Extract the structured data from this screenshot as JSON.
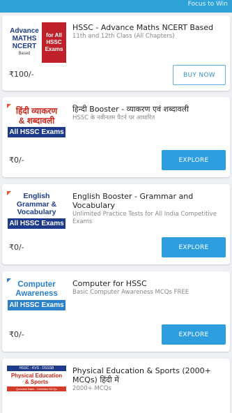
{
  "top_bar": {
    "text": "Focus to Win"
  },
  "courses": [
    {
      "title": "HSSC - Advance Maths NCERT Based",
      "subtitle": "11th and 12th Class (All Chapters)",
      "price": "₹100/-",
      "button": "BUY NOW",
      "thumb": {
        "line1": "Advance",
        "line2": "MATHS",
        "line3": "NCERT",
        "line4": "Based",
        "right1": "for All",
        "right2": "HSSC",
        "right3": "Exams"
      }
    },
    {
      "title": "हिन्दी Booster - व्याकरण एवं शब्दावली",
      "subtitle": "HSSC के नवीनतम पैटर्न पर आधारित",
      "price": "₹0/-",
      "button": "EXPLORE",
      "thumb": {
        "line1": "हिंदी व्याकरण",
        "line2": "& शब्दावली",
        "band": "All HSSC Exams"
      }
    },
    {
      "title": "English Booster - Grammar and Vocabulary",
      "subtitle": "Unlimited Practice Tests for All India Competitive Exams",
      "price": "₹0/-",
      "button": "EXPLORE",
      "thumb": {
        "line1": "English",
        "line2": "Grammar &",
        "line3": "Vocabulary",
        "band": "All HSSC Exams"
      }
    },
    {
      "title": "Computer for HSSC",
      "subtitle": "Basic Computer Awareness MCQs FREE",
      "price": "₹0/-",
      "button": "EXPLORE",
      "thumb": {
        "line1": "Computer",
        "line2": "Awareness",
        "band": "All HSSC Exams"
      }
    },
    {
      "title": "Physical Education & Sports (2000+ MCQs) हिंदी में",
      "subtitle": "2000+ MCQs",
      "thumb": {
        "header": "HSSC - KVS - DSSSB",
        "line1": "Physical Education",
        "line2": "& Sports",
        "footer": "Question Bank - Unlimited MCQs"
      }
    }
  ],
  "colors": {
    "accent": "#2d9ddd",
    "top_bar": "#2fa3d8",
    "book_red": "#c0202a",
    "book_blue": "#1e3a8a"
  }
}
